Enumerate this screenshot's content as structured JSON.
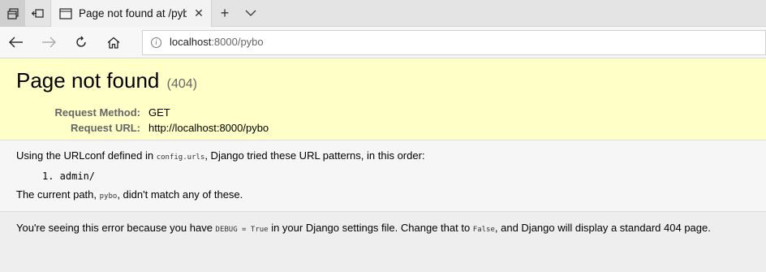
{
  "browser": {
    "tab_title": "Page not found at /pybo",
    "address_host": "localhost",
    "address_rest": ":8000/pybo"
  },
  "page": {
    "title": "Page not found",
    "status_code": "(404)",
    "request_method_label": "Request Method:",
    "request_method": "GET",
    "request_url_label": "Request URL:",
    "request_url": "http://localhost:8000/pybo",
    "urlconf_prefix": "Using the URLconf defined in ",
    "urlconf_name": "config.urls",
    "urlconf_suffix": ", Django tried these URL patterns, in this order:",
    "patterns": [
      "1. admin/"
    ],
    "path_prefix": "The current path, ",
    "path_value": "pybo",
    "path_suffix": ", didn't match any of these.",
    "expl_part1": "You're seeing this error because you have ",
    "expl_code1": "DEBUG = True",
    "expl_part2": " in your Django settings file. Change that to ",
    "expl_code2": "False",
    "expl_part3": ", and Django will display a standard 404 page."
  }
}
